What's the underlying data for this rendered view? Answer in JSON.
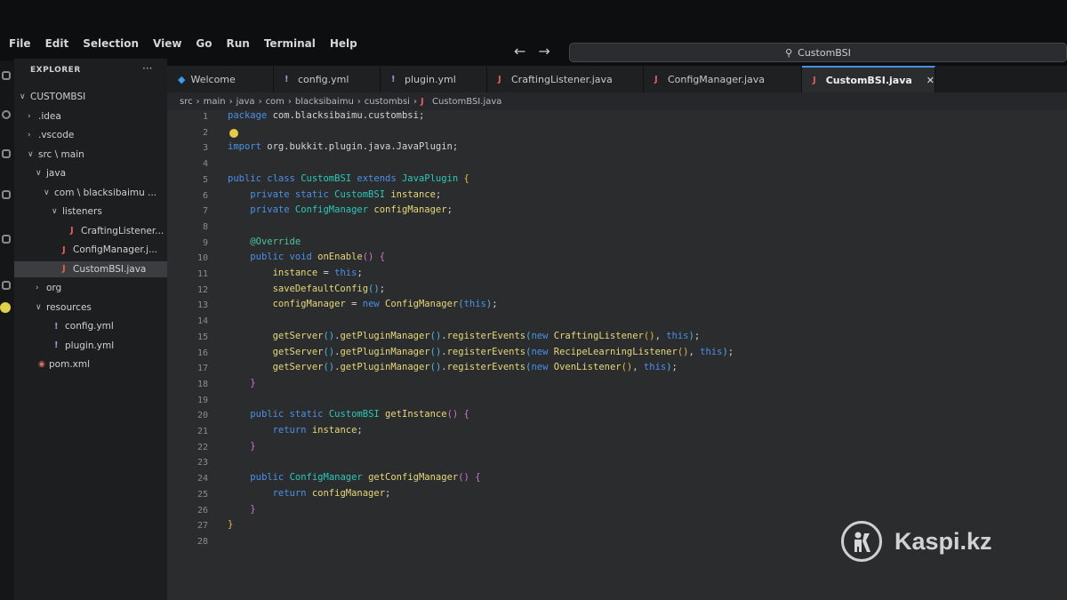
{
  "menu": [
    "File",
    "Edit",
    "Selection",
    "View",
    "Go",
    "Run",
    "Terminal",
    "Help"
  ],
  "search": {
    "value": "CustomBSI"
  },
  "explorer": {
    "title": "EXPLORER",
    "tree": [
      {
        "label": "CUSTOMBSI",
        "depth": 0,
        "chevron": "open",
        "icon": ""
      },
      {
        "label": ".idea",
        "depth": 1,
        "chevron": "closed",
        "icon": ""
      },
      {
        "label": ".vscode",
        "depth": 1,
        "chevron": "closed",
        "icon": ""
      },
      {
        "label": "src \\ main",
        "depth": 1,
        "chevron": "open",
        "icon": ""
      },
      {
        "label": "java",
        "depth": 2,
        "chevron": "open",
        "icon": ""
      },
      {
        "label": "com \\ blacksibaimu ...",
        "depth": 3,
        "chevron": "open",
        "icon": ""
      },
      {
        "label": "listeners",
        "depth": 4,
        "chevron": "open",
        "icon": ""
      },
      {
        "label": "CraftingListener...",
        "depth": 5,
        "chevron": "",
        "icon": "java"
      },
      {
        "label": "ConfigManager.j...",
        "depth": 4,
        "chevron": "",
        "icon": "java"
      },
      {
        "label": "CustomBSI.java",
        "depth": 4,
        "chevron": "",
        "icon": "java",
        "selected": true
      },
      {
        "label": "org",
        "depth": 2,
        "chevron": "closed",
        "icon": ""
      },
      {
        "label": "resources",
        "depth": 2,
        "chevron": "open",
        "icon": ""
      },
      {
        "label": "config.yml",
        "depth": 3,
        "chevron": "",
        "icon": "yml"
      },
      {
        "label": "plugin.yml",
        "depth": 3,
        "chevron": "",
        "icon": "yml"
      },
      {
        "label": "pom.xml",
        "depth": 1,
        "chevron": "",
        "icon": "xml"
      }
    ]
  },
  "tabs": [
    {
      "label": "Welcome",
      "icon": "vscode-icon"
    },
    {
      "label": "config.yml",
      "icon": "yml-icon"
    },
    {
      "label": "plugin.yml",
      "icon": "yml-icon"
    },
    {
      "label": "CraftingListener.java",
      "icon": "java-icon"
    },
    {
      "label": "ConfigManager.java",
      "icon": "java-icon"
    },
    {
      "label": "CustomBSI.java",
      "icon": "java-icon",
      "active": true
    }
  ],
  "breadcrumb": [
    "src",
    "main",
    "java",
    "com",
    "blacksibaimu",
    "custombsi",
    "CustomBSI.java"
  ],
  "code": [
    [
      [
        "kw",
        "package "
      ],
      [
        "pk",
        "com.blacksibaimu.custombsi;"
      ]
    ],
    [],
    [
      [
        "kw",
        "import "
      ],
      [
        "pk",
        "org.bukkit.plugin.java.JavaPlugin;"
      ]
    ],
    [],
    [
      [
        "kw",
        "public class "
      ],
      [
        "ty",
        "CustomBSI "
      ],
      [
        "kw",
        "extends "
      ],
      [
        "ty",
        "JavaPlugin "
      ],
      [
        "br1",
        "{"
      ]
    ],
    [
      [
        "pk",
        "    "
      ],
      [
        "kw",
        "private static "
      ],
      [
        "ty",
        "CustomBSI "
      ],
      [
        "fn",
        "instance"
      ],
      [
        "pk",
        ";"
      ]
    ],
    [
      [
        "pk",
        "    "
      ],
      [
        "kw",
        "private "
      ],
      [
        "ty",
        "ConfigManager "
      ],
      [
        "fn",
        "configManager"
      ],
      [
        "pk",
        ";"
      ]
    ],
    [],
    [
      [
        "pk",
        "    "
      ],
      [
        "an",
        "@Override"
      ]
    ],
    [
      [
        "pk",
        "    "
      ],
      [
        "kw",
        "public void "
      ],
      [
        "fn",
        "onEnable"
      ],
      [
        "br2",
        "() {"
      ]
    ],
    [
      [
        "pk",
        "        "
      ],
      [
        "fn",
        "instance "
      ],
      [
        "pk",
        "= "
      ],
      [
        "kw",
        "this"
      ],
      [
        "pk",
        ";"
      ]
    ],
    [
      [
        "pk",
        "        "
      ],
      [
        "fn",
        "saveDefaultConfig"
      ],
      [
        "br3",
        "()"
      ],
      [
        "pk",
        ";"
      ]
    ],
    [
      [
        "pk",
        "        "
      ],
      [
        "fn",
        "configManager "
      ],
      [
        "pk",
        "= "
      ],
      [
        "kw",
        "new "
      ],
      [
        "fn",
        "ConfigManager"
      ],
      [
        "br3",
        "("
      ],
      [
        "kw",
        "this"
      ],
      [
        "br3",
        ")"
      ],
      [
        "pk",
        ";"
      ]
    ],
    [],
    [
      [
        "pk",
        "        "
      ],
      [
        "fn",
        "getServer"
      ],
      [
        "br3",
        "()"
      ],
      [
        "pk",
        "."
      ],
      [
        "fn",
        "getPluginManager"
      ],
      [
        "br3",
        "()"
      ],
      [
        "pk",
        "."
      ],
      [
        "fn",
        "registerEvents"
      ],
      [
        "br3",
        "("
      ],
      [
        "kw",
        "new "
      ],
      [
        "fn",
        "CraftingListener"
      ],
      [
        "br1",
        "()"
      ],
      [
        "pk",
        ", "
      ],
      [
        "kw",
        "this"
      ],
      [
        "br3",
        ")"
      ],
      [
        "pk",
        ";"
      ]
    ],
    [
      [
        "pk",
        "        "
      ],
      [
        "fn",
        "getServer"
      ],
      [
        "br3",
        "()"
      ],
      [
        "pk",
        "."
      ],
      [
        "fn",
        "getPluginManager"
      ],
      [
        "br3",
        "()"
      ],
      [
        "pk",
        "."
      ],
      [
        "fn",
        "registerEvents"
      ],
      [
        "br3",
        "("
      ],
      [
        "kw",
        "new "
      ],
      [
        "fn",
        "RecipeLearningListener"
      ],
      [
        "br1",
        "()"
      ],
      [
        "pk",
        ", "
      ],
      [
        "kw",
        "this"
      ],
      [
        "br3",
        ")"
      ],
      [
        "pk",
        ";"
      ]
    ],
    [
      [
        "pk",
        "        "
      ],
      [
        "fn",
        "getServer"
      ],
      [
        "br3",
        "()"
      ],
      [
        "pk",
        "."
      ],
      [
        "fn",
        "getPluginManager"
      ],
      [
        "br3",
        "()"
      ],
      [
        "pk",
        "."
      ],
      [
        "fn",
        "registerEvents"
      ],
      [
        "br3",
        "("
      ],
      [
        "kw",
        "new "
      ],
      [
        "fn",
        "OvenListener"
      ],
      [
        "br1",
        "()"
      ],
      [
        "pk",
        ", "
      ],
      [
        "kw",
        "this"
      ],
      [
        "br3",
        ")"
      ],
      [
        "pk",
        ";"
      ]
    ],
    [
      [
        "pk",
        "    "
      ],
      [
        "br2",
        "}"
      ]
    ],
    [],
    [
      [
        "pk",
        "    "
      ],
      [
        "kw",
        "public static "
      ],
      [
        "ty",
        "CustomBSI "
      ],
      [
        "fn",
        "getInstance"
      ],
      [
        "br2",
        "() {"
      ]
    ],
    [
      [
        "pk",
        "        "
      ],
      [
        "kw",
        "return "
      ],
      [
        "fn",
        "instance"
      ],
      [
        "pk",
        ";"
      ]
    ],
    [
      [
        "pk",
        "    "
      ],
      [
        "br2",
        "}"
      ]
    ],
    [],
    [
      [
        "pk",
        "    "
      ],
      [
        "kw",
        "public "
      ],
      [
        "ty",
        "ConfigManager "
      ],
      [
        "fn",
        "getConfigManager"
      ],
      [
        "br2",
        "() {"
      ]
    ],
    [
      [
        "pk",
        "        "
      ],
      [
        "kw",
        "return "
      ],
      [
        "fn",
        "configManager"
      ],
      [
        "pk",
        ";"
      ]
    ],
    [
      [
        "pk",
        "    "
      ],
      [
        "br2",
        "}"
      ]
    ],
    [
      [
        "br1",
        "}"
      ]
    ],
    []
  ],
  "watermark": {
    "text": "Kaspi.kz"
  }
}
